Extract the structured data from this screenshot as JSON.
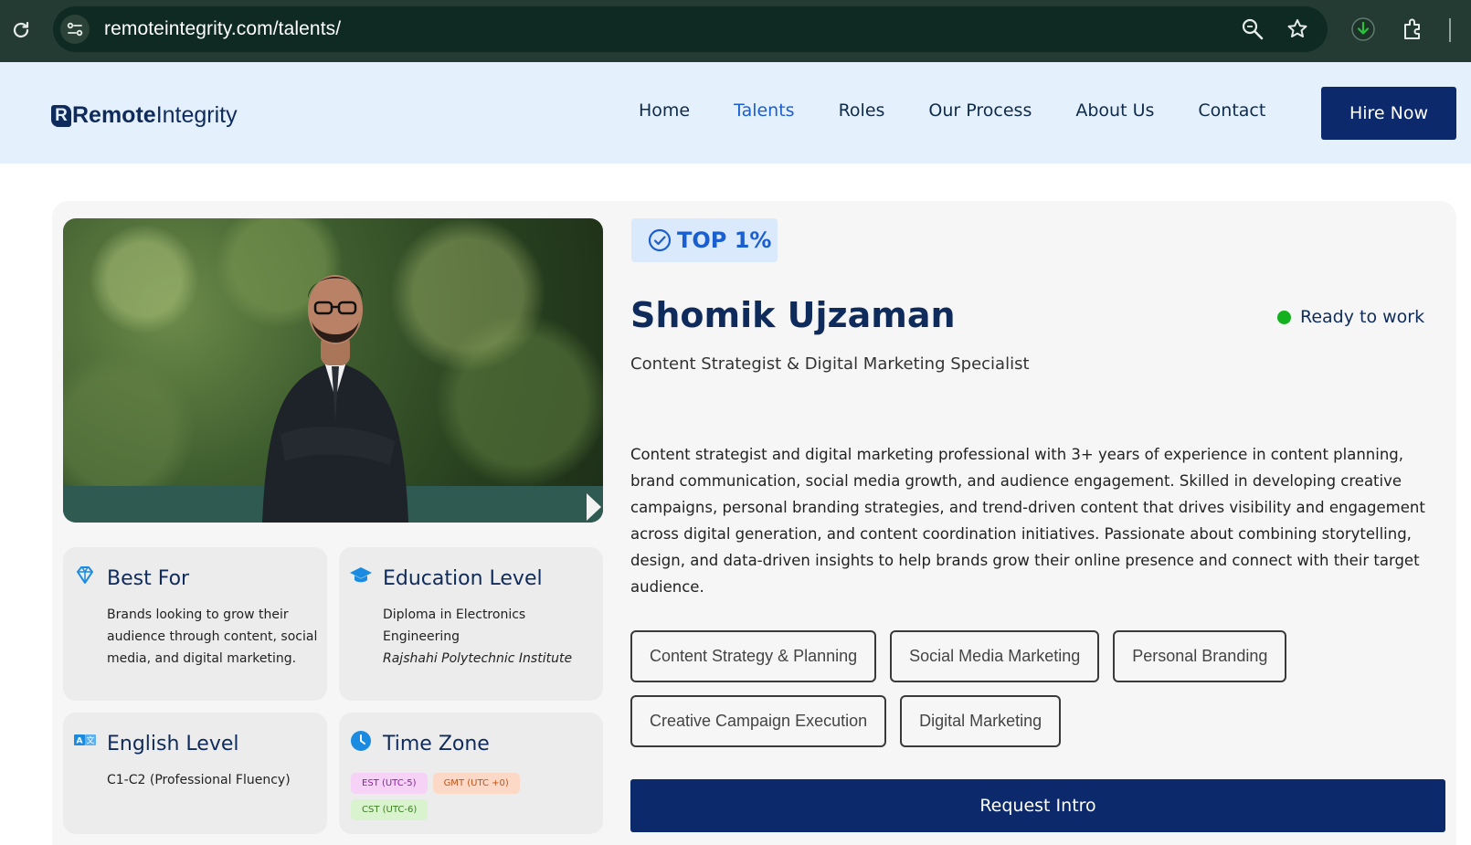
{
  "browser": {
    "url": "remoteintegrity.com/talents/",
    "icons": [
      "reload-icon",
      "site-info-icon",
      "zoom-icon",
      "star-icon",
      "download-icon",
      "extensions-icon"
    ]
  },
  "site": {
    "logo_bold": "Remote",
    "logo_light": "Integrity",
    "nav": [
      "Home",
      "Talents",
      "Roles",
      "Our Process",
      "About Us",
      "Contact"
    ],
    "active_nav": "Talents",
    "hire_button": "Hire Now",
    "brand_color": "#0c2a6b",
    "accent_color": "#1a5fd0"
  },
  "profile": {
    "badge": "TOP 1%",
    "name": "Shomik Ujzaman",
    "status": "Ready to work",
    "status_color": "#13b01f",
    "role": "Content Strategist & Digital Marketing Specialist",
    "bio": "Content strategist and digital marketing professional with 3+ years of experience in content planning, brand communication, social media growth, and audience engagement. Skilled in developing creative campaigns, personal branding strategies, and trend-driven content that drives visibility and engagement across digital generation, and content coordination initiatives. Passionate about combining storytelling, design, and data-driven insights to help brands grow their online presence and connect with their target audience.",
    "skills": [
      "Content Strategy & Planning",
      "Social Media Marketing",
      "Personal Branding",
      "Creative Campaign Execution",
      "Digital Marketing"
    ],
    "request_button": "Request Intro",
    "best_for": {
      "title": "Best For",
      "text": "Brands looking to grow their audience through content, social media, and digital marketing."
    },
    "education": {
      "title": "Education Level",
      "degree": "Diploma in Electronics Engineering",
      "institute": "Rajshahi Polytechnic Institute"
    },
    "english": {
      "title": "English Level",
      "text": "C1-C2 (Professional Fluency)"
    },
    "timezone": {
      "title": "Time Zone",
      "badges": [
        {
          "label": "EST (UTC-5)",
          "bg": "#f6d3f6",
          "fg": "#8a1ea3"
        },
        {
          "label": "GMT (UTC +0)",
          "bg": "#fbd9c6",
          "fg": "#c0531a"
        },
        {
          "label": "CST (UTC-6)",
          "bg": "#d9f3cf",
          "fg": "#3d7d22"
        }
      ]
    }
  }
}
